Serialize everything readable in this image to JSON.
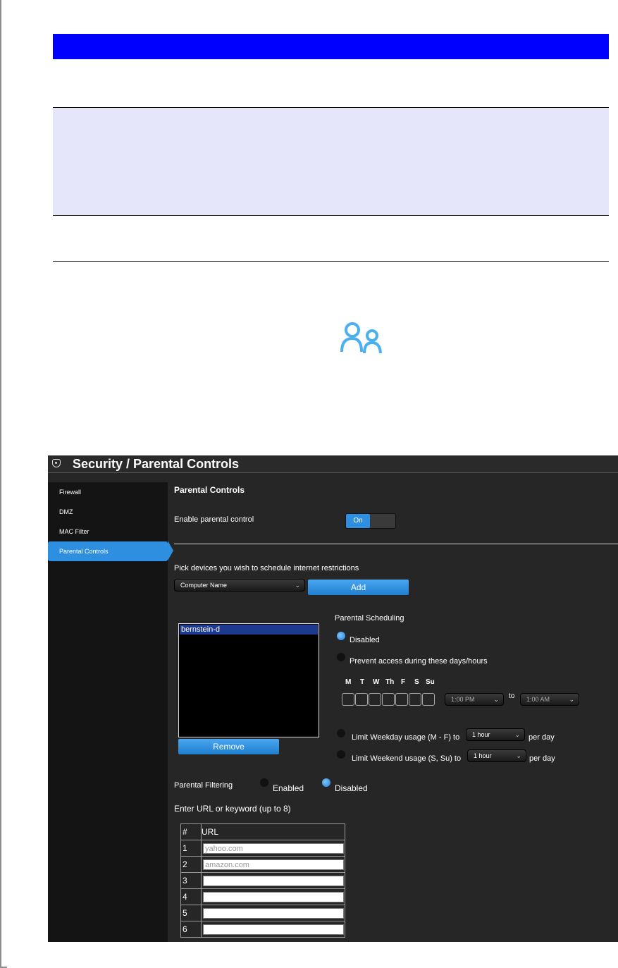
{
  "screenshot": {
    "header": {
      "title": "Security / Parental Controls",
      "icon": "shield-icon"
    },
    "sidebar": {
      "items": [
        {
          "label": "Firewall",
          "active": false
        },
        {
          "label": "DMZ",
          "active": false
        },
        {
          "label": "MAC Filter",
          "active": false
        },
        {
          "label": "Parental Controls",
          "active": true
        }
      ]
    },
    "main": {
      "section_title": "Parental Controls",
      "enable_label": "Enable parental control",
      "toggle_on_label": "On",
      "pick_devices_label": "Pick devices you wish to schedule internet restrictions",
      "computer_select": "Computer Name",
      "add_button": "Add",
      "device_list": [
        "bernstein-d"
      ],
      "remove_button": "Remove",
      "scheduling": {
        "title": "Parental Scheduling",
        "disabled_label": "Disabled",
        "prevent_label": "Prevent access during these days/hours",
        "days": [
          "M",
          "T",
          "W",
          "Th",
          "F",
          "S",
          "Su"
        ],
        "from_time": "1:00 PM",
        "to_label": "to",
        "to_time": "1:00 AM",
        "weekday_label": "Limit Weekday usage (M - F) to",
        "weekday_value": "1 hour",
        "weekend_label": "Limit Weekend usage (S, Su) to",
        "weekend_value": "1 hour",
        "per_day": "per day"
      },
      "filtering": {
        "label": "Parental Filtering",
        "enabled_label": "Enabled",
        "disabled_label": "Disabled",
        "url_prompt": "Enter URL or keyword (up to 8)",
        "col_num": "#",
        "col_url": "URL",
        "rows": [
          {
            "n": "1",
            "url": "yahoo.com"
          },
          {
            "n": "2",
            "url": "amazon.com"
          },
          {
            "n": "3",
            "url": ""
          },
          {
            "n": "4",
            "url": ""
          },
          {
            "n": "5",
            "url": ""
          },
          {
            "n": "6",
            "url": ""
          }
        ]
      }
    }
  },
  "colors": {
    "table_header": "#0000ff",
    "band_shade": "#e6e6fa",
    "accent": "#2e8fe0",
    "icon": "#4ab0f0"
  }
}
